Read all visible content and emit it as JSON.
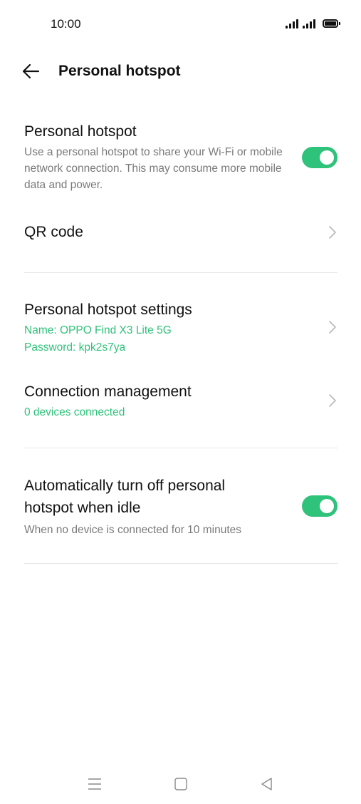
{
  "status_bar": {
    "time": "10:00"
  },
  "header": {
    "back_icon": "arrow-left-icon",
    "title": "Personal hotspot"
  },
  "hotspot": {
    "title": "Personal hotspot",
    "description": "Use a personal hotspot to share your Wi-Fi or mobile network connection. This may consume more mobile data and power.",
    "enabled": true
  },
  "qr_code": {
    "label": "QR code"
  },
  "hotspot_settings": {
    "title": "Personal hotspot settings",
    "name_line": "Name: OPPO Find X3 Lite 5G",
    "password_line": "Password: kpk2s7ya"
  },
  "connection_management": {
    "title": "Connection management",
    "status": "0 devices connected"
  },
  "auto_off": {
    "title": "Automatically turn off personal hotspot when idle",
    "description": "When no device is connected for 10 minutes",
    "enabled": true
  },
  "navigation_bar": {
    "menu_icon": "menu-icon",
    "home_icon": "home-square-icon",
    "back_icon": "back-triangle-icon"
  },
  "colors": {
    "accent": "#2fc27a",
    "text_primary": "#111111",
    "text_secondary": "#7a7a7a",
    "divider": "#e6e6e6",
    "background": "#ffffff"
  }
}
